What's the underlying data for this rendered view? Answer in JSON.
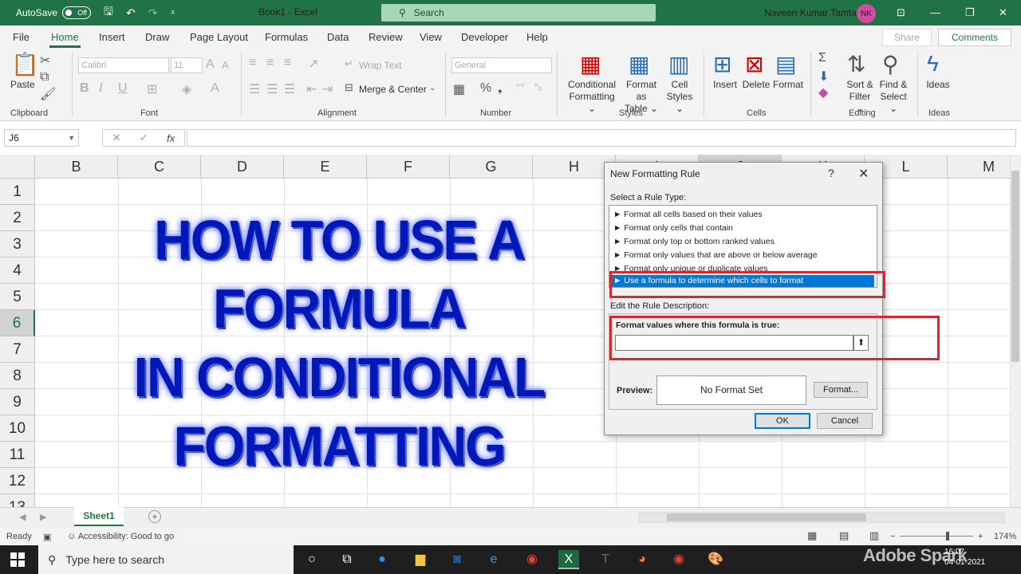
{
  "titlebar": {
    "autosave_label": "AutoSave",
    "autosave_state": "Off",
    "doc_title": "Book1  -  Excel",
    "search_placeholder": "Search",
    "user_name": "Naveen Kumar Tamta",
    "user_initials": "NK",
    "accent_color": "#217346"
  },
  "menu": {
    "tabs": [
      "File",
      "Home",
      "Insert",
      "Draw",
      "Page Layout",
      "Formulas",
      "Data",
      "Review",
      "View",
      "Developer",
      "Help"
    ],
    "active": "Home",
    "share_label": "Share",
    "comments_label": "Comments"
  },
  "ribbon": {
    "clipboard": {
      "paste": "Paste",
      "group": "Clipboard"
    },
    "font": {
      "name": "Calibri",
      "size": "11",
      "group": "Font"
    },
    "alignment": {
      "wrap_text": "Wrap Text",
      "merge_center": "Merge & Center",
      "group": "Alignment"
    },
    "number": {
      "format": "General",
      "percent": "%",
      "group": "Number"
    },
    "styles": {
      "conditional_formatting_1": "Conditional",
      "conditional_formatting_2": "Formatting",
      "format_as_table_1": "Format as",
      "format_as_table_2": "Table",
      "cell_styles_1": "Cell",
      "cell_styles_2": "Styles",
      "group": "Styles"
    },
    "cells": {
      "insert": "Insert",
      "delete": "Delete",
      "format": "Format",
      "group": "Cells"
    },
    "editing": {
      "sort_filter_1": "Sort &",
      "sort_filter_2": "Filter",
      "find_select_1": "Find &",
      "find_select_2": "Select",
      "group": "Editing"
    },
    "ideas": {
      "label": "Ideas",
      "group": "Ideas"
    }
  },
  "formula_bar": {
    "name_box": "J6",
    "fx": "fx",
    "cancel_glyph": "✕",
    "enter_glyph": "✓"
  },
  "grid": {
    "columns": [
      "B",
      "C",
      "D",
      "E",
      "F",
      "G",
      "H",
      "I",
      "J",
      "K",
      "L",
      "M"
    ],
    "rows": [
      "1",
      "2",
      "3",
      "4",
      "5",
      "6",
      "7",
      "8",
      "9",
      "10",
      "11",
      "12",
      "13"
    ],
    "selected_row": "6"
  },
  "headline": {
    "line1": "HOW TO USE A FORMULA",
    "line2": "IN CONDITIONAL",
    "line3": "FORMATTING"
  },
  "dialog": {
    "title": "New Formatting Rule",
    "help": "?",
    "close": "✕",
    "select_rule_type_label": "Select a Rule Type:",
    "rule_types": [
      "► Format all cells based on their values",
      "► Format only cells that contain",
      "► Format only top or bottom ranked values",
      "► Format only values that are above or below average",
      "► Format only unique or duplicate values",
      "► Use a formula to determine which cells to format"
    ],
    "selected_rule_index": 5,
    "edit_description_label": "Edit the Rule Description:",
    "formula_label": "Format values where this formula is true:",
    "formula_value": "",
    "collapse_glyph": "⬆",
    "preview_label": "Preview:",
    "preview_text": "No Format Set",
    "format_button": "Format...",
    "ok_button": "OK",
    "cancel_button": "Cancel",
    "highlight_color": "#e0242c",
    "selection_color": "#0078d7"
  },
  "sheets": {
    "tabs": [
      "Sheet1"
    ],
    "active": "Sheet1"
  },
  "statusbar": {
    "ready": "Ready",
    "accessibility": "Accessibility: Good to go",
    "zoom": "174%"
  },
  "taskbar": {
    "search_placeholder": "Type here to search",
    "time": "16:07",
    "date": "04-01-2021",
    "watermark": "Adobe Spark"
  }
}
